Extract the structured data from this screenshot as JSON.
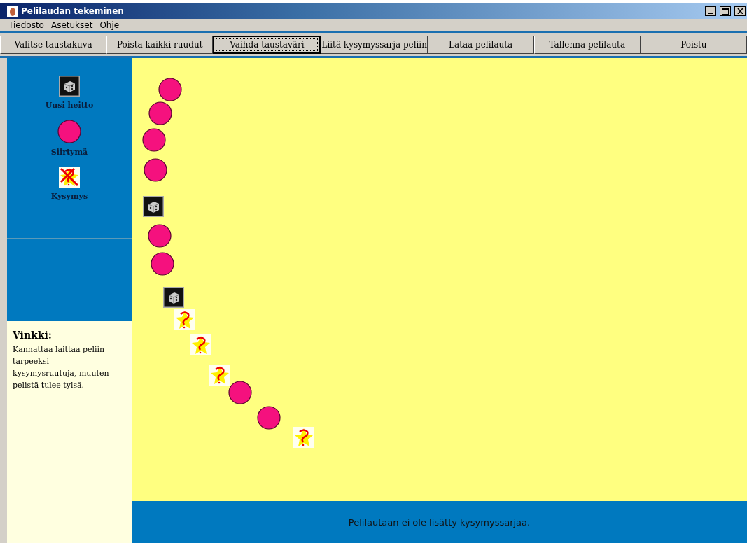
{
  "window": {
    "title": "Pelilaudan tekeminen"
  },
  "menu": [
    {
      "label": "Tiedosto"
    },
    {
      "label": "Asetukset"
    },
    {
      "label": "Ohje"
    }
  ],
  "toolbar": [
    {
      "label": "Valitse taustakuva",
      "focused": false
    },
    {
      "label": "Poista kaikki ruudut",
      "focused": false
    },
    {
      "label": "Vaihda taustaväri",
      "focused": true
    },
    {
      "label": "Liitä kysymyssarja peliin",
      "focused": false
    },
    {
      "label": "Lataa pelilauta",
      "focused": false
    },
    {
      "label": "Tallenna pelilauta",
      "focused": false
    },
    {
      "label": "Poistu",
      "focused": false
    }
  ],
  "palette": [
    {
      "kind": "dice",
      "label": "Uusi heitto"
    },
    {
      "kind": "move",
      "label": "Siirtymä"
    },
    {
      "kind": "question",
      "label": "Kysymys"
    }
  ],
  "tip": {
    "title": "Vinkki:",
    "text": "Kannattaa laittaa peliin tarpeeksi kysymysruutuja, muuten pelistä tulee tylsä."
  },
  "board": {
    "tiles": [
      {
        "kind": "move"
      },
      {
        "kind": "move"
      },
      {
        "kind": "move"
      },
      {
        "kind": "move"
      },
      {
        "kind": "dice"
      },
      {
        "kind": "move"
      },
      {
        "kind": "move"
      },
      {
        "kind": "dice"
      },
      {
        "kind": "question"
      },
      {
        "kind": "question"
      },
      {
        "kind": "question"
      },
      {
        "kind": "move"
      },
      {
        "kind": "move"
      },
      {
        "kind": "question"
      }
    ]
  },
  "status": "Pelilautaan ei ole lisätty kysymyssarjaa."
}
